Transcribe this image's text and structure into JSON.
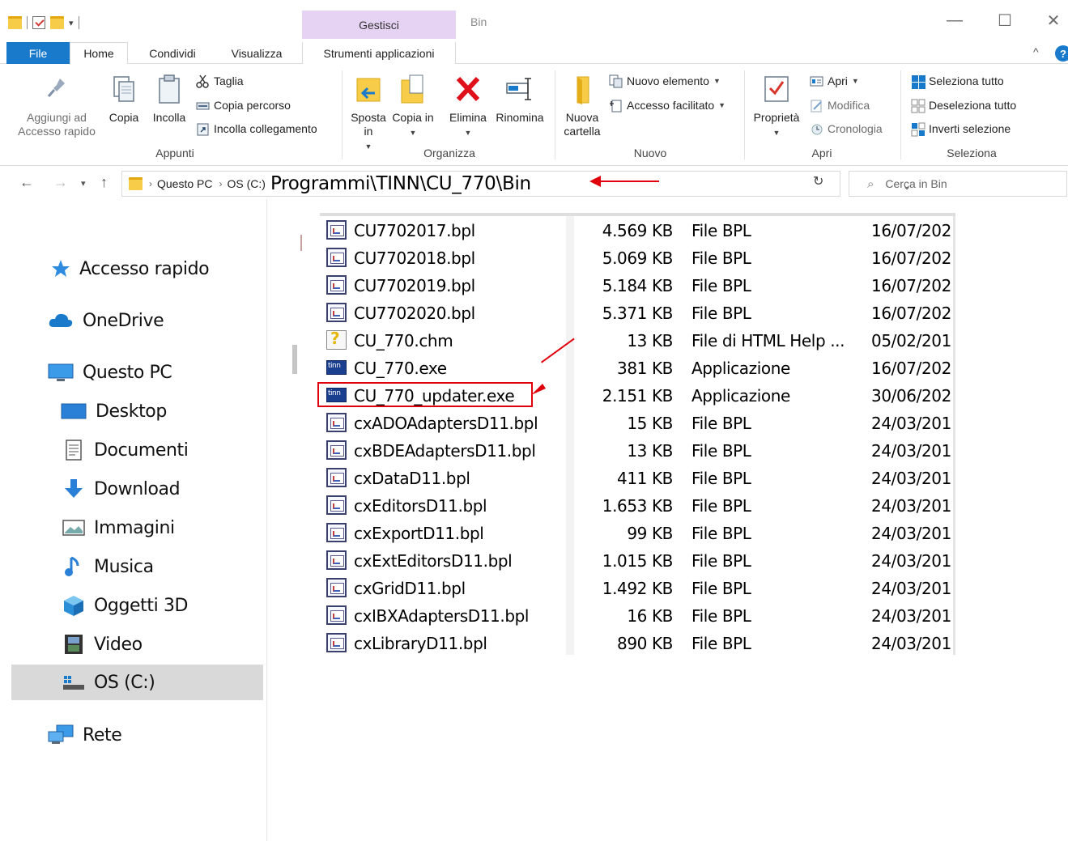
{
  "window": {
    "title": "Bin",
    "contextual_group": "Gestisci",
    "controls": {
      "minimize": "—",
      "maximize": "☐",
      "close": "✕"
    }
  },
  "ribbon_tabs": [
    "File",
    "Home",
    "Condividi",
    "Visualizza",
    "Strumenti applicazioni"
  ],
  "ribbon": {
    "appunti": {
      "label": "Appunti",
      "pin": "Aggiungi ad Accesso rapido",
      "copy": "Copia",
      "paste": "Incolla",
      "cut": "Taglia",
      "copy_path": "Copia percorso",
      "paste_shortcut": "Incolla collegamento"
    },
    "organizza": {
      "label": "Organizza",
      "move_to": "Sposta in",
      "copy_to": "Copia in",
      "delete": "Elimina",
      "rename": "Rinomina"
    },
    "nuovo": {
      "label": "Nuovo",
      "new_folder": "Nuova cartella",
      "new_item": "Nuovo elemento",
      "easy_access": "Accesso facilitato"
    },
    "apri": {
      "label": "Apri",
      "properties": "Proprietà",
      "open": "Apri",
      "edit": "Modifica",
      "history": "Cronologia"
    },
    "seleziona": {
      "label": "Seleziona",
      "select_all": "Seleziona tutto",
      "select_none": "Deseleziona tutto",
      "invert": "Inverti selezione"
    }
  },
  "address": {
    "crumbs": [
      "Questo PC",
      "OS (C:)"
    ],
    "overlay_path": "Programmi\\TINN\\CU_770\\Bin",
    "search_placeholder": "Cerca in Bin"
  },
  "sidebar": {
    "items": [
      {
        "label": "Accesso rapido",
        "icon": "star-icon"
      },
      {
        "label": "OneDrive",
        "icon": "cloud-icon"
      },
      {
        "label": "Questo PC",
        "icon": "computer-icon"
      },
      {
        "label": "Desktop",
        "icon": "desktop-icon"
      },
      {
        "label": "Documenti",
        "icon": "documents-icon"
      },
      {
        "label": "Download",
        "icon": "download-icon"
      },
      {
        "label": "Immagini",
        "icon": "pictures-icon"
      },
      {
        "label": "Musica",
        "icon": "music-icon"
      },
      {
        "label": "Oggetti 3D",
        "icon": "cube-icon"
      },
      {
        "label": "Video",
        "icon": "film-icon"
      },
      {
        "label": "OS (C:)",
        "icon": "drive-icon",
        "selected": true
      },
      {
        "label": "Rete",
        "icon": "network-icon"
      }
    ]
  },
  "files": [
    {
      "name": "CU7702017.bpl",
      "size": "4.569 KB",
      "type": "File BPL",
      "date": "16/07/202",
      "icon": "bpl"
    },
    {
      "name": "CU7702018.bpl",
      "size": "5.069 KB",
      "type": "File BPL",
      "date": "16/07/202",
      "icon": "bpl"
    },
    {
      "name": "CU7702019.bpl",
      "size": "5.184 KB",
      "type": "File BPL",
      "date": "16/07/202",
      "icon": "bpl"
    },
    {
      "name": "CU7702020.bpl",
      "size": "5.371 KB",
      "type": "File BPL",
      "date": "16/07/202",
      "icon": "bpl"
    },
    {
      "name": "CU_770.chm",
      "size": "13 KB",
      "type": "File di HTML Help ...",
      "date": "05/02/201",
      "icon": "chm"
    },
    {
      "name": "CU_770.exe",
      "size": "381 KB",
      "type": "Applicazione",
      "date": "16/07/202",
      "icon": "exe"
    },
    {
      "name": "CU_770_updater.exe",
      "size": "2.151 KB",
      "type": "Applicazione",
      "date": "30/06/202",
      "icon": "exe",
      "highlighted": true
    },
    {
      "name": "cxADOAdaptersD11.bpl",
      "size": "15 KB",
      "type": "File BPL",
      "date": "24/03/201",
      "icon": "bpl"
    },
    {
      "name": "cxBDEAdaptersD11.bpl",
      "size": "13 KB",
      "type": "File BPL",
      "date": "24/03/201",
      "icon": "bpl"
    },
    {
      "name": "cxDataD11.bpl",
      "size": "411 KB",
      "type": "File BPL",
      "date": "24/03/201",
      "icon": "bpl"
    },
    {
      "name": "cxEditorsD11.bpl",
      "size": "1.653 KB",
      "type": "File BPL",
      "date": "24/03/201",
      "icon": "bpl"
    },
    {
      "name": "cxExportD11.bpl",
      "size": "99 KB",
      "type": "File BPL",
      "date": "24/03/201",
      "icon": "bpl"
    },
    {
      "name": "cxExtEditorsD11.bpl",
      "size": "1.015 KB",
      "type": "File BPL",
      "date": "24/03/201",
      "icon": "bpl"
    },
    {
      "name": "cxGridD11.bpl",
      "size": "1.492 KB",
      "type": "File BPL",
      "date": "24/03/201",
      "icon": "bpl"
    },
    {
      "name": "cxIBXAdaptersD11.bpl",
      "size": "16 KB",
      "type": "File BPL",
      "date": "24/03/201",
      "icon": "bpl"
    },
    {
      "name": "cxLibraryD11.bpl",
      "size": "890 KB",
      "type": "File BPL",
      "date": "24/03/201",
      "icon": "bpl"
    }
  ],
  "colors": {
    "accent": "#1979ca",
    "contextual_tab": "#e6d3f3",
    "annotation": "#e0000b",
    "selection": "#d9d9d9"
  }
}
